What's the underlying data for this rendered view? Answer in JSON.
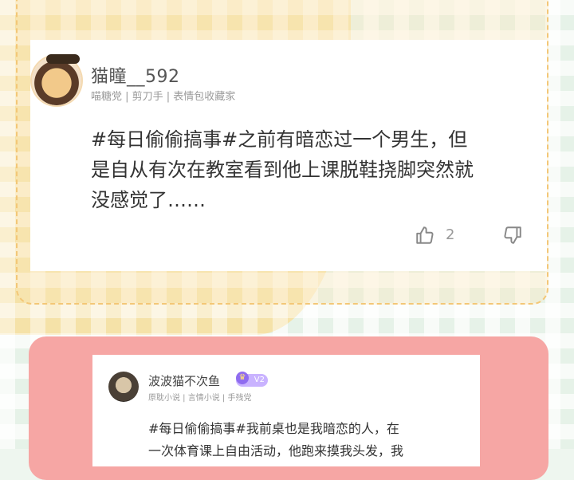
{
  "post1": {
    "username": "猫瞳__592",
    "tags": "喵糖党 | 剪刀手 | 表情包收藏家",
    "content_line1": "#每日偷偷搞事#之前有暗恋过一个男生，但",
    "content_line2": "是自从有次在教室看到他上课脱鞋挠脚突然就",
    "content_line3": "没感觉了……",
    "like_count": "2"
  },
  "post2": {
    "username": "波波猫不次鱼",
    "badge": "V2",
    "tags": "原耽小说 | 言情小说 | 手残党",
    "content_line1": "#每日偷偷搞事#我前桌也是我暗恋的人，在",
    "content_line2": "一次体育课上自由活动，他跑来摸我头发，我"
  },
  "colors": {
    "yellow_bg": "#f5e2a8",
    "green_bg": "#e6f2e8",
    "pink_frame": "#f6a6a4",
    "badge_purple": "#8f6cf0"
  }
}
